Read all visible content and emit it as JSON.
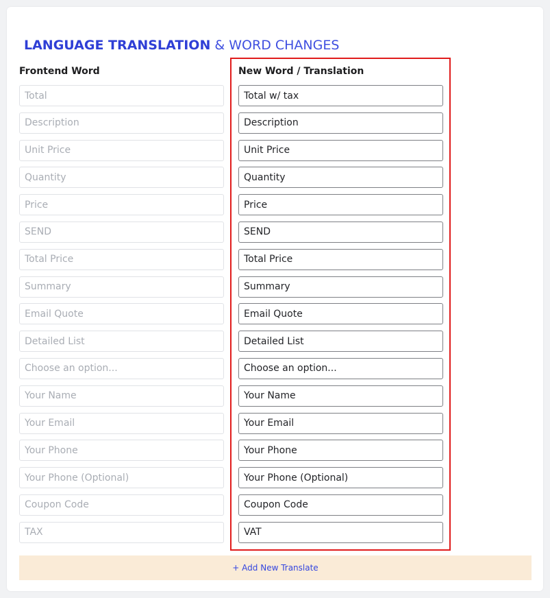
{
  "header": {
    "title_strong": "LANGUAGE TRANSLATION",
    "title_rest": "& WORD CHANGES"
  },
  "columns": {
    "frontend_label": "Frontend Word",
    "new_label": "New Word / Translation"
  },
  "rows": [
    {
      "frontend": "Total",
      "translation": "Total w/ tax"
    },
    {
      "frontend": "Description",
      "translation": "Description"
    },
    {
      "frontend": "Unit Price",
      "translation": "Unit Price"
    },
    {
      "frontend": "Quantity",
      "translation": "Quantity"
    },
    {
      "frontend": "Price",
      "translation": "Price"
    },
    {
      "frontend": "SEND",
      "translation": "SEND"
    },
    {
      "frontend": "Total Price",
      "translation": "Total Price"
    },
    {
      "frontend": "Summary",
      "translation": "Summary"
    },
    {
      "frontend": "Email Quote",
      "translation": "Email Quote"
    },
    {
      "frontend": "Detailed List",
      "translation": "Detailed List"
    },
    {
      "frontend": "Choose an option...",
      "translation": "Choose an option..."
    },
    {
      "frontend": "Your Name",
      "translation": "Your Name"
    },
    {
      "frontend": "Your Email",
      "translation": "Your Email"
    },
    {
      "frontend": "Your Phone",
      "translation": "Your Phone"
    },
    {
      "frontend": "Your Phone (Optional)",
      "translation": "Your Phone (Optional)"
    },
    {
      "frontend": "Coupon Code",
      "translation": "Coupon Code"
    },
    {
      "frontend": "TAX",
      "translation": "VAT"
    }
  ],
  "actions": {
    "add_label": "+ Add New Translate"
  },
  "colors": {
    "accent": "#2f3fd6",
    "highlight": "#e01b1b",
    "add_bar_bg": "#faebd7"
  }
}
